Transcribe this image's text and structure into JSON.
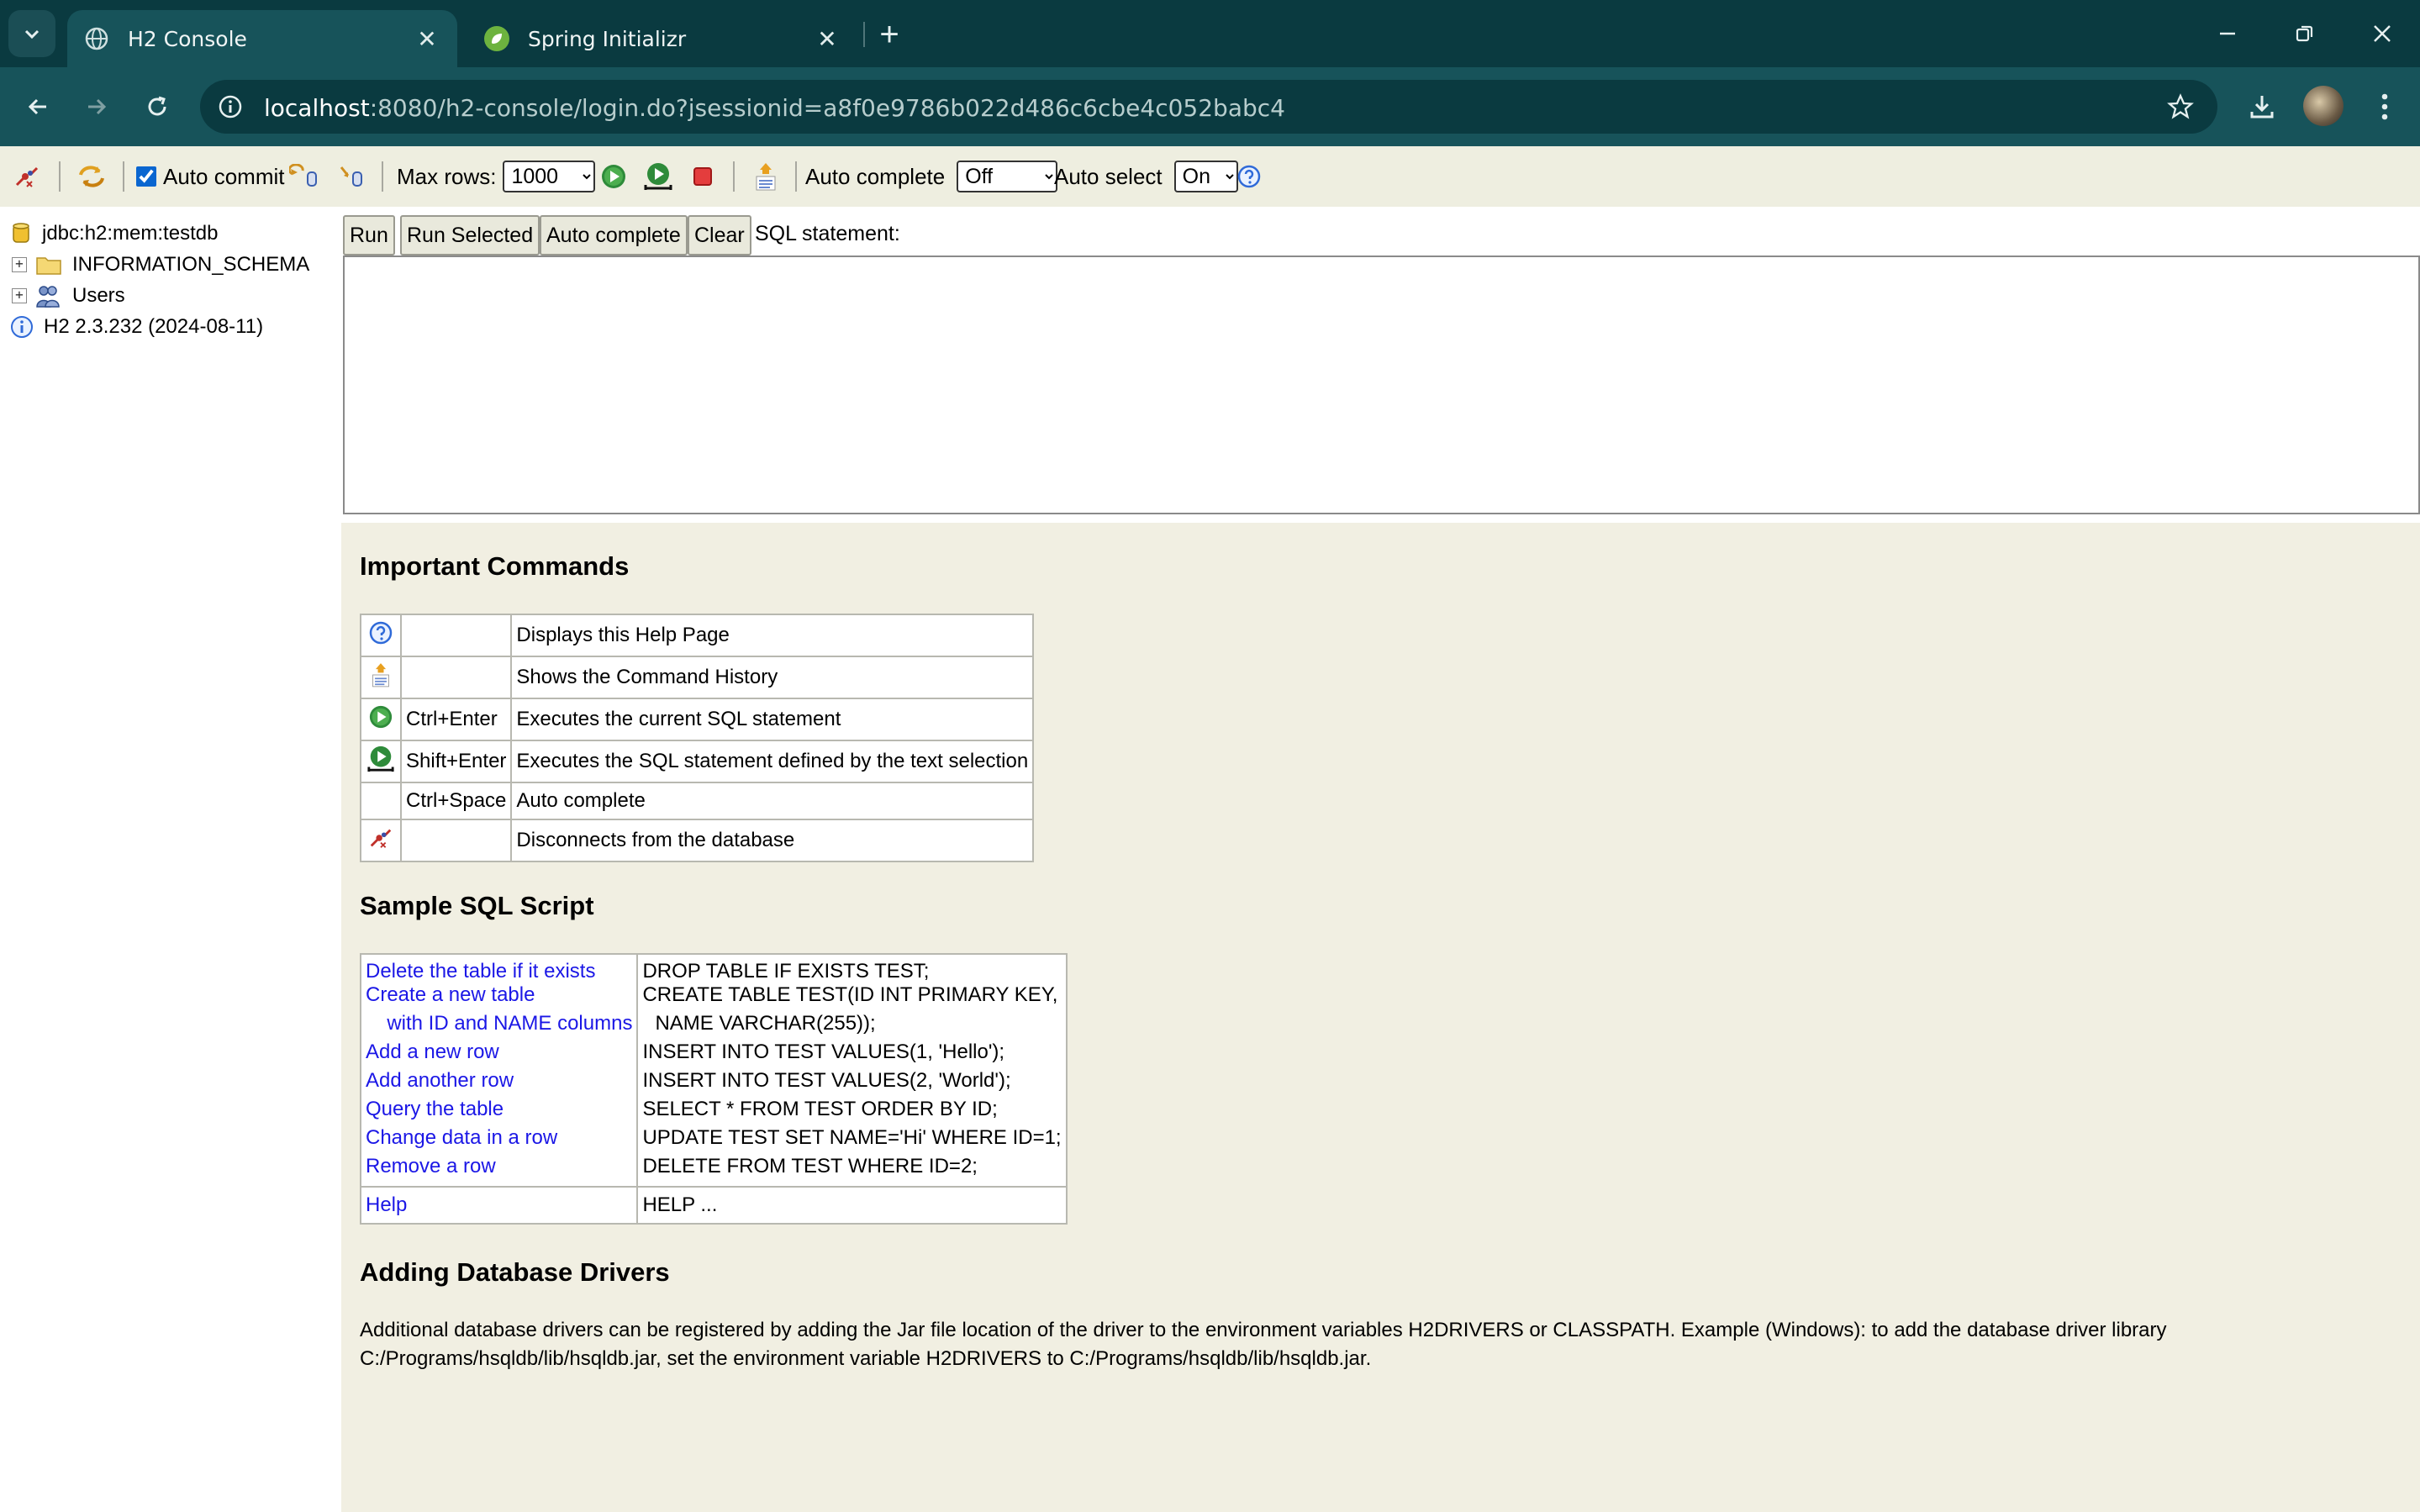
{
  "browser": {
    "tabs": [
      {
        "title": "H2 Console",
        "active": true
      },
      {
        "title": "Spring Initializr",
        "active": false
      }
    ],
    "address": {
      "host": "localhost",
      "rest": ":8080/h2-console/login.do?jsessionid=a8f0e9786b022d486c6cbe4c052babc4"
    }
  },
  "toolbar": {
    "auto_commit_label": "Auto commit",
    "auto_commit_checked": true,
    "max_rows_label": "Max rows:",
    "max_rows_value": "1000",
    "auto_complete_label": "Auto complete",
    "auto_complete_value": "Off",
    "auto_select_label": "Auto select",
    "auto_select_value": "On"
  },
  "tree": {
    "connection": "jdbc:h2:mem:testdb",
    "nodes": [
      "INFORMATION_SCHEMA",
      "Users"
    ],
    "version": "H2 2.3.232 (2024-08-11)"
  },
  "query": {
    "buttons": {
      "run": "Run",
      "run_selected": "Run Selected",
      "auto_complete": "Auto complete",
      "clear": "Clear"
    },
    "sql_label": "SQL statement:"
  },
  "help": {
    "important_title": "Important Commands",
    "commands": [
      {
        "icon": "help-icon",
        "key": "",
        "desc": "Displays this Help Page"
      },
      {
        "icon": "history-icon",
        "key": "",
        "desc": "Shows the Command History"
      },
      {
        "icon": "run-icon",
        "key": "Ctrl+Enter",
        "desc": "Executes the current SQL statement"
      },
      {
        "icon": "run-selected-icon",
        "key": "Shift+Enter",
        "desc": "Executes the SQL statement defined by the text selection"
      },
      {
        "icon": "",
        "key": "Ctrl+Space",
        "desc": "Auto complete"
      },
      {
        "icon": "disconnect-icon",
        "key": "",
        "desc": "Disconnects from the database"
      }
    ],
    "sample_title": "Sample SQL Script",
    "sample": [
      {
        "label": "Delete the table if it exists",
        "sql": "DROP TABLE IF EXISTS TEST;"
      },
      {
        "label": "Create a new table",
        "sql": "CREATE TABLE TEST(ID INT PRIMARY KEY,"
      },
      {
        "label": "  with ID and NAME columns",
        "sql": "   NAME VARCHAR(255));"
      },
      {
        "label": "Add a new row",
        "sql": "INSERT INTO TEST VALUES(1, 'Hello');"
      },
      {
        "label": "Add another row",
        "sql": "INSERT INTO TEST VALUES(2, 'World');"
      },
      {
        "label": "Query the table",
        "sql": "SELECT * FROM TEST ORDER BY ID;"
      },
      {
        "label": "Change data in a row",
        "sql": "UPDATE TEST SET NAME='Hi' WHERE ID=1;"
      },
      {
        "label": "Remove a row",
        "sql": "DELETE FROM TEST WHERE ID=2;"
      }
    ],
    "sample_help": {
      "label": "Help",
      "sql": "HELP ..."
    },
    "drivers_title": "Adding Database Drivers",
    "drivers_text": "Additional database drivers can be registered by adding the Jar file location of the driver to the environment variables H2DRIVERS or CLASSPATH. Example (Windows): to add the database driver library C:/Programs/hsqldb/lib/hsqldb.jar, set the environment variable H2DRIVERS to C:/Programs/hsqldb/lib/hsqldb.jar."
  },
  "colors": {
    "chrome_dark": "#0a3a40",
    "chrome_tab": "#17535a",
    "h2_bar": "#eeeee0",
    "help_bg": "#f1efe2",
    "link": "#1b17e6"
  }
}
